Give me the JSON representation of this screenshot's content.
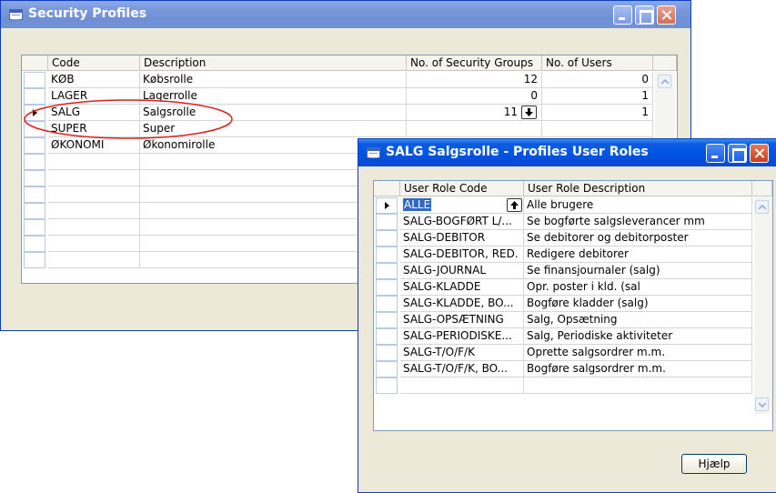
{
  "security_profiles": {
    "title": "Security Profiles",
    "columns": [
      "Code",
      "Description",
      "No. of Security Groups",
      "No. of Users"
    ],
    "rows": [
      {
        "code": "KØB",
        "description": "Købsrolle",
        "groups": "12",
        "users": "0"
      },
      {
        "code": "LAGER",
        "description": "Lagerrolle",
        "groups": "0",
        "users": "1"
      },
      {
        "code": "SALG",
        "description": "Salgsrolle",
        "groups": "11",
        "users": "1"
      },
      {
        "code": "SUPER",
        "description": "Super",
        "groups": "",
        "users": ""
      },
      {
        "code": "ØKONOMI",
        "description": "Økonomirolle",
        "groups": "",
        "users": ""
      }
    ],
    "selected_row": "SALG"
  },
  "profile_user_roles": {
    "title": "SALG Salgsrolle - Profiles User Roles",
    "columns": [
      "User Role Code",
      "User Role Description"
    ],
    "rows": [
      {
        "code": "ALLE",
        "description": "Alle brugere"
      },
      {
        "code": "SALG-BOGFØRT L/...",
        "description": "Se bogførte salgsleverancer mm"
      },
      {
        "code": "SALG-DEBITOR",
        "description": "Se debitorer og debitorposter"
      },
      {
        "code": "SALG-DEBITOR, RED.",
        "description": "Redigere debitorer"
      },
      {
        "code": "SALG-JOURNAL",
        "description": "Se finansjournaler (salg)"
      },
      {
        "code": "SALG-KLADDE",
        "description": "Opr. poster i kld. (sal"
      },
      {
        "code": "SALG-KLADDE, BO...",
        "description": "Bogføre kladder (salg)"
      },
      {
        "code": "SALG-OPSÆTNING",
        "description": "Salg, Opsætning"
      },
      {
        "code": "SALG-PERIODISKE...",
        "description": "Salg, Periodiske aktiviteter"
      },
      {
        "code": "SALG-T/O/F/K",
        "description": "Oprette salgsordrer m.m."
      },
      {
        "code": "SALG-T/O/F/K, BO...",
        "description": "Bogføre salgsordrer m.m."
      }
    ],
    "selected_row": "ALLE",
    "help_button": "Hjælp"
  },
  "colors": {
    "title_active": "#0054e3",
    "title_inactive": "#7a98dc",
    "window_face": "#ece9d8",
    "selection": "#316ac5",
    "annotation": "#e0201c"
  },
  "icons": [
    "window-icon",
    "minimize-icon",
    "maximize-icon",
    "close-icon",
    "row-pointer-icon",
    "lookup-arrow-icon",
    "scroll-up-icon",
    "scroll-down-icon"
  ]
}
